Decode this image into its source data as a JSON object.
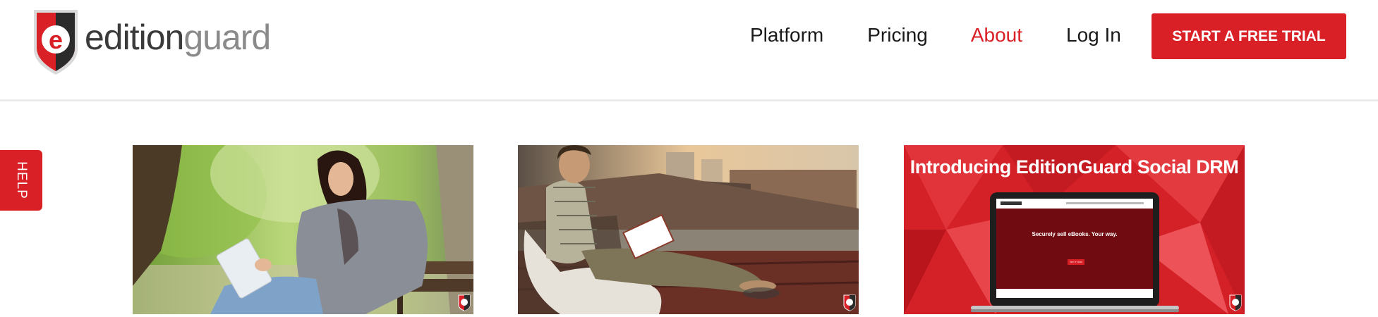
{
  "logo": {
    "letter": "e",
    "text_edition": "edition",
    "text_guard": "guard"
  },
  "nav": {
    "items": [
      {
        "label": "Platform",
        "active": false
      },
      {
        "label": "Pricing",
        "active": false
      },
      {
        "label": "About",
        "active": true
      },
      {
        "label": "Log In",
        "active": false
      }
    ]
  },
  "cta": {
    "label": "START A FREE TRIAL"
  },
  "help": {
    "label": "HELP"
  },
  "cards": [
    {
      "kind": "photo-woman-tablet"
    },
    {
      "kind": "photo-man-reading"
    },
    {
      "kind": "promo",
      "title": "Introducing EditionGuard Social DRM",
      "screen": {
        "heading": "Securely sell eBooks. Your way.",
        "button": "TRY IT NOW"
      }
    }
  ],
  "colors": {
    "brand_red": "#d92027",
    "text_dark": "#1a1a1a"
  }
}
